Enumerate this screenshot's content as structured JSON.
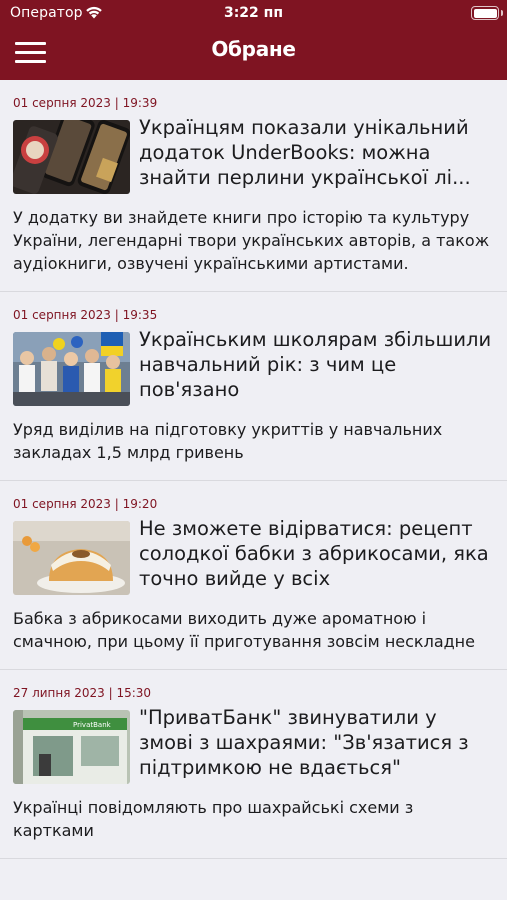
{
  "status_bar": {
    "carrier": "Оператор",
    "time": "3:22 пп"
  },
  "nav": {
    "title": "Обране"
  },
  "colors": {
    "brand": "#7f1422",
    "date_text": "#7f1422",
    "background": "#efeff4"
  },
  "articles": [
    {
      "date": "01 серпня 2023 | 19:39",
      "headline": "Українцям показали унікальний додаток UnderBooks: можна знайти перлини української лі...",
      "summary": "У додатку ви знайдете книги про історію та культуру України, легендарні твори українських авторів, а також аудіокниги, озвучені українськими артистами."
    },
    {
      "date": "01 серпня 2023 | 19:35",
      "headline": "Українським школярам збільшили навчальний рік: з чим це пов'язано",
      "summary": "Уряд виділив на підготовку укриттів у навчальних закладах 1,5 млрд гривень"
    },
    {
      "date": "01 серпня 2023 | 19:20",
      "headline": "Не зможете відірватися: рецепт солодкої бабки з абрикосами, яка точно вийде у всіх",
      "summary": "Бабка з абрикосами виходить дуже ароматною і смачною, при цьому її приготування зовсім нескладне"
    },
    {
      "date": "27 липня 2023 | 15:30",
      "headline": "\"ПриватБанк\" звинуватили у змові з шахраями: \"Зв'язатися з підтримкою не вдається\"",
      "summary": "Українці повідомляють про шахрайські схеми з картками"
    }
  ]
}
